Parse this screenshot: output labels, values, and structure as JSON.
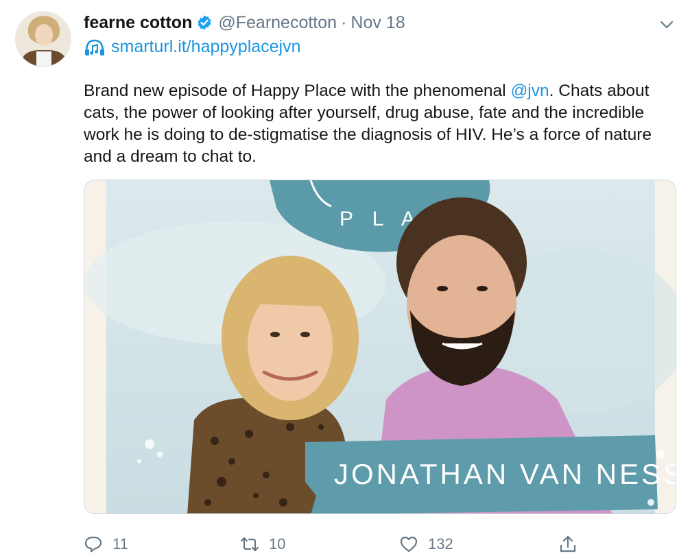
{
  "tweet": {
    "author_name": "fearne cotton",
    "handle": "@Fearnecotton",
    "separator": "·",
    "date": "Nov 18",
    "bio_link": "smarturl.it/happyplacejvn",
    "text_before_mention": "Brand new episode of Happy Place with the phenomenal ",
    "mention": "@jvn",
    "text_after_mention": ". Chats about cats, the power of looking after yourself, drug abuse, fate and the incredible work he is doing to de-stigmatise the diagnosis of HIV. He’s a force of nature and a dream to chat to."
  },
  "media": {
    "logo_text": "P L A C",
    "banner_text": "JONATHAN VAN NESS"
  },
  "actions": {
    "replies": "11",
    "retweets": "10",
    "likes": "132"
  },
  "colors": {
    "link": "#1b95e0",
    "muted": "#657786",
    "verified": "#1da1f2",
    "banner": "#5e9cab"
  },
  "icons": [
    "verified-badge-icon",
    "chevron-down-icon",
    "music-icon",
    "reply-icon",
    "retweet-icon",
    "like-icon",
    "share-icon"
  ]
}
